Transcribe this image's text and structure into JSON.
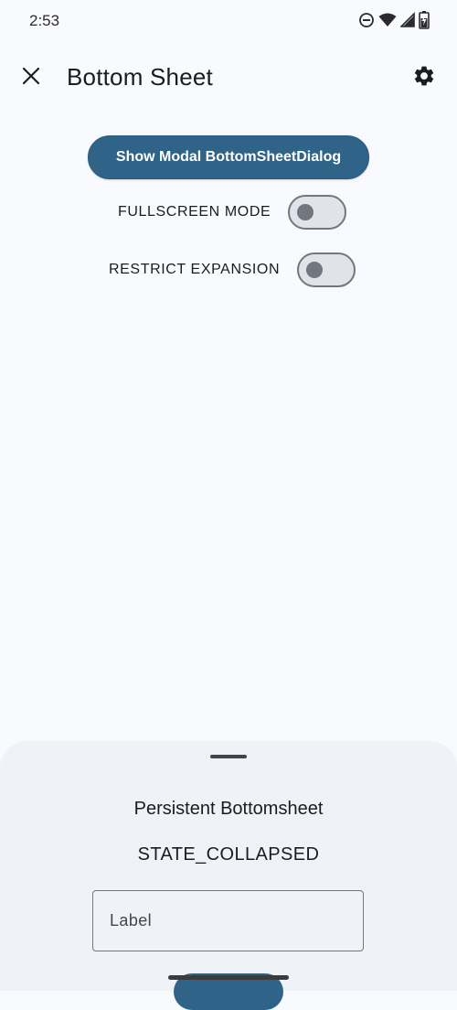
{
  "status_bar": {
    "time": "2:53",
    "icons": [
      "do-not-disturb-icon",
      "wifi-icon",
      "cell-signal-icon",
      "battery-charging-icon"
    ]
  },
  "app_bar": {
    "title": "Bottom Sheet",
    "navigation_icon": "close-icon",
    "action_icon": "gear-icon"
  },
  "main": {
    "show_dialog_button": "Show Modal BottomSheetDialog",
    "switches": [
      {
        "label": "FULLSCREEN MODE",
        "checked": false
      },
      {
        "label": "RESTRICT EXPANSION",
        "checked": false
      }
    ]
  },
  "bottom_sheet": {
    "title": "Persistent Bottomsheet",
    "state": "STATE_COLLAPSED",
    "text_field_placeholder": "Label"
  },
  "colors": {
    "background": "#f8fafd",
    "primary": "#2f6488",
    "sheet_surface": "#eff2f6",
    "outline": "#72777f"
  }
}
